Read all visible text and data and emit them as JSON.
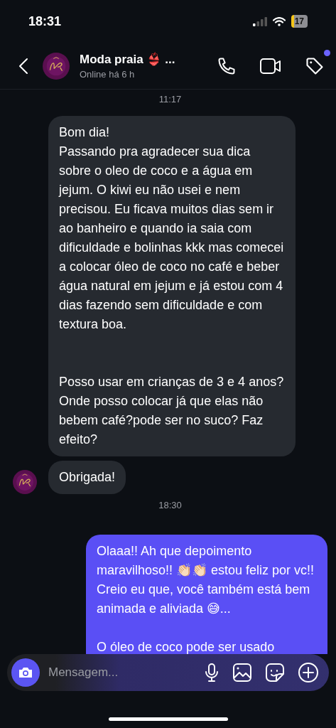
{
  "status_bar": {
    "time": "18:31",
    "battery": "17"
  },
  "header": {
    "title": "Moda praia 👙 ...",
    "subtitle": "Online há 6 h",
    "notification_dot": true
  },
  "messages": [
    {
      "kind": "time",
      "text": "11:17"
    },
    {
      "kind": "received",
      "avatar": false,
      "text": "Bom dia!\nPassando pra agradecer sua dica sobre o oleo de coco e a água em jejum. O kiwi eu não usei e nem precisou. Eu ficava muitos dias sem ir ao banheiro e quando ia saia com dificuldade e bolinhas kkk mas comecei a colocar óleo de coco no café e beber água natural em jejum e já estou com 4 dias fazendo sem dificuldade e com textura boa.\n\n\nPosso usar em crianças de 3 e 4 anos?\nOnde posso colocar já que elas não bebem café?pode ser no suco? Faz efeito?"
    },
    {
      "kind": "received",
      "avatar": true,
      "text": "Obrigada!"
    },
    {
      "kind": "time",
      "text": "18:30"
    },
    {
      "kind": "sent",
      "avatar": false,
      "text": "Olaaa!! Ah que depoimento maravilhoso!! 👏🏻👏🏻 estou feliz por vc!! Creio eu que, você também está bem animada e aliviada 😅...\n\nO óleo de coco pode ser usado"
    }
  ],
  "composer": {
    "placeholder": "Mensagem..."
  }
}
